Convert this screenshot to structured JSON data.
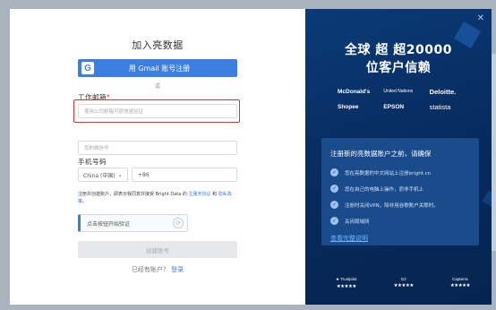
{
  "form": {
    "title": "加入亮数据",
    "gmail_button": "用 Gmail 账号注册",
    "or_text": "或",
    "email_label": "工作邮箱",
    "required_mark": "*",
    "email_placeholder": "使用公司邮箱可获快速验证",
    "name_placeholder": "您的微信号",
    "phone_label": "手机号码",
    "country_value": "China (中国)",
    "phone_prefix": "+86",
    "terms_prefix": "注册并创建账户，即表示我同意并接受 Bright Data 的",
    "terms_link_1": "主服务协议",
    "terms_and": "和",
    "terms_link_2": "隐私政策",
    "terms_end": "。",
    "verify_text": "点击按钮开始验证",
    "create_button": "创建账号",
    "login_prompt": "已经有账户？",
    "login_link": "登录"
  },
  "promo": {
    "headline_line1": "全球 超 超20000",
    "headline_line2": "位客户信赖",
    "logos": [
      "McDonald's",
      "United Nations",
      "Deloitte.",
      "Shopee",
      "EPSON",
      "statista"
    ],
    "card_title": "注册新的亮数据账户之前，请确保",
    "checklist": [
      "您在亮数据的中文网站上注册bright.cn",
      "您在自己的电脑上操作，而非手机上",
      "注册时关闭VPN，除非用谷歌账户关联时。",
      "关闭局域网"
    ],
    "details_link": "查看完整说明",
    "ratings": [
      {
        "name": "★ Trustpilot",
        "stars": "★★★★★"
      },
      {
        "name": "G2",
        "stars": "★★★★★"
      },
      {
        "name": "Capterra",
        "stars": "★★★★★"
      }
    ]
  },
  "colors": {
    "accent": "#3d7fe0",
    "panel": "#072a5c",
    "highlight": "#e23030"
  }
}
